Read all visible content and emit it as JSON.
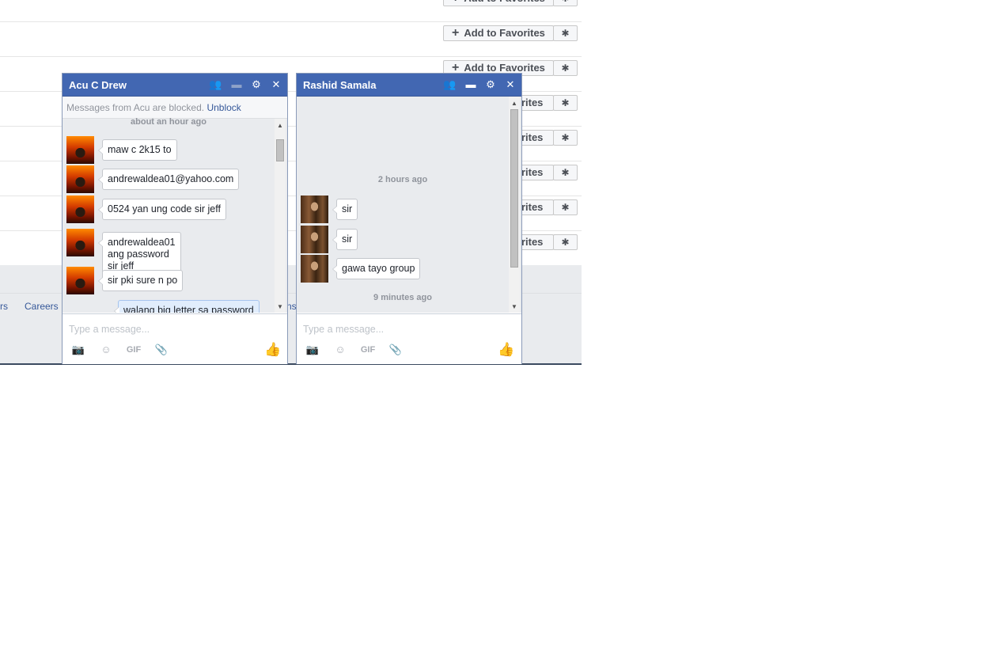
{
  "background": {
    "favorites_label": "Add to Favorites",
    "favorites_partial": "orites",
    "footer_links": [
      "rs",
      "Careers",
      "ns"
    ],
    "gear_glyph": "✱"
  },
  "chat1": {
    "title": "Acu C Drew",
    "blocked_text": "Messages from Acu are blocked.",
    "unblock_label": "Unblock",
    "timestamp": "about an hour ago",
    "messages": [
      {
        "text": "maw c 2k15 to"
      },
      {
        "text": "andrewaldea01@yahoo.com"
      },
      {
        "text": "0524 yan ung code sir jeff"
      },
      {
        "text": "andrewaldea01 ang password\nsir jeff"
      },
      {
        "text": "sir pki sure n po"
      }
    ],
    "own_message": "walang big letter sa password",
    "placeholder": "Type a message...",
    "icons": [
      "add-friend-icon",
      "video-call-icon",
      "gear-icon",
      "close-icon"
    ]
  },
  "chat2": {
    "title": "Rashid Samala",
    "timestamps": [
      "2 hours ago",
      "9 minutes ago"
    ],
    "messages": [
      {
        "text": "sir"
      },
      {
        "text": "sir"
      },
      {
        "text": "gawa tayo group"
      }
    ],
    "placeholder": "Type a message...",
    "icons": [
      "add-friend-icon",
      "video-call-icon",
      "gear-icon",
      "close-icon"
    ]
  },
  "composer_tools": {
    "gif_label": "GIF",
    "camera": "camera-icon",
    "emoji": "emoji-icon",
    "attach": "attach-icon",
    "like": "like-icon"
  },
  "glyphs": {
    "close": "✕",
    "gear": "⚙",
    "camera": "📷",
    "emoji": "☺",
    "attach": "📎",
    "like": "👍",
    "add_friend": "👥",
    "video": "▬",
    "plus": "+",
    "up": "▲",
    "down": "▼"
  }
}
